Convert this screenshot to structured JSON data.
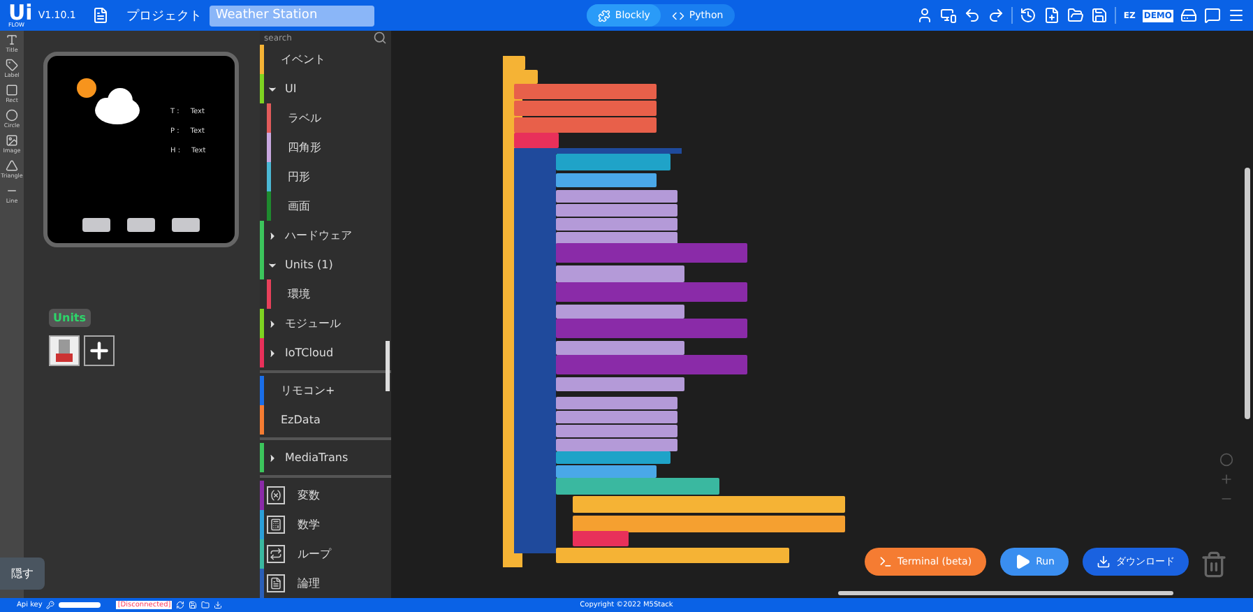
{
  "header": {
    "logo": "Ui",
    "logo_sub": "FLOW",
    "version": "V1.10.1",
    "project_label": "プロジェクト",
    "project_name": "Weather Station",
    "modes": [
      {
        "label": "Blockly",
        "selected": true
      },
      {
        "label": "Python",
        "selected": false
      }
    ],
    "toolbar": [
      {
        "kind": "user"
      },
      {
        "kind": "device"
      },
      {
        "kind": "undo"
      },
      {
        "kind": "redo"
      },
      {
        "kind": "sep"
      },
      {
        "kind": "history"
      },
      {
        "kind": "new"
      },
      {
        "kind": "open"
      },
      {
        "kind": "save"
      },
      {
        "kind": "sep"
      },
      {
        "kind": "ez",
        "label": "EZ"
      },
      {
        "kind": "demo",
        "label": "DEMO"
      },
      {
        "kind": "device2"
      },
      {
        "kind": "chat"
      },
      {
        "kind": "menu"
      }
    ]
  },
  "tools": [
    {
      "label": "Title",
      "kind": "title"
    },
    {
      "label": "Label",
      "kind": "label"
    },
    {
      "label": "Rect",
      "kind": "rect"
    },
    {
      "label": "Circle",
      "kind": "circle"
    },
    {
      "label": "Image",
      "kind": "image"
    },
    {
      "label": "Triangle",
      "kind": "triangle"
    },
    {
      "label": "Line",
      "kind": "line"
    }
  ],
  "screen": {
    "rows": [
      {
        "key": "T :",
        "value": "Text"
      },
      {
        "key": "P :",
        "value": "Text"
      },
      {
        "key": "H :",
        "value": "Text"
      }
    ]
  },
  "units": {
    "title": "Units"
  },
  "hide_button": "隠す",
  "search": {
    "placeholder": "search"
  },
  "categories": [
    {
      "label": "イベント",
      "color": "#f5b335",
      "kind": "plain"
    },
    {
      "label": "UI",
      "color": "#7ed321",
      "kind": "group",
      "expanded": true
    },
    {
      "label": "ラベル",
      "color": "#e25b5b",
      "kind": "sub"
    },
    {
      "label": "四角形",
      "color": "#c9a8e0",
      "kind": "sub"
    },
    {
      "label": "円形",
      "color": "#4bb8d4",
      "kind": "sub"
    },
    {
      "label": "画面",
      "color": "#1e8a2e",
      "kind": "sub"
    },
    {
      "label": "ハードウェア",
      "color": "#3cc45c",
      "kind": "group",
      "expanded": false
    },
    {
      "label": "Units (1)",
      "color": "#3cc45c",
      "kind": "group",
      "expanded": true
    },
    {
      "label": "環境",
      "color": "#e8405a",
      "kind": "sub"
    },
    {
      "label": "モジュール",
      "color": "#7ed321",
      "kind": "group",
      "expanded": false
    },
    {
      "label": "IoTCloud",
      "color": "#e8305a",
      "kind": "group",
      "expanded": false
    },
    {
      "kind": "sep"
    },
    {
      "label": "リモコン+",
      "color": "#1a6ee8",
      "kind": "plain"
    },
    {
      "label": "EzData",
      "color": "#f57c32",
      "kind": "plain"
    },
    {
      "kind": "sep"
    },
    {
      "label": "MediaTrans",
      "color": "#3cc45c",
      "kind": "group",
      "expanded": false
    },
    {
      "kind": "sep"
    },
    {
      "label": "変数",
      "color": "#8a2ba8",
      "kind": "icon"
    },
    {
      "label": "数学",
      "color": "#2b9fd8",
      "kind": "icon"
    },
    {
      "label": "ループ",
      "color": "#3ab8a0",
      "kind": "icon"
    },
    {
      "label": "論理",
      "color": "#2b5fb8",
      "kind": "icon"
    }
  ],
  "actions": [
    {
      "label": "Terminal (beta)",
      "kind": "terminal"
    },
    {
      "label": "Run",
      "kind": "run"
    },
    {
      "label": "ダウンロード",
      "kind": "download"
    }
  ],
  "status": {
    "api_key_label": "Api key",
    "connection": "[Disconnected]",
    "copyright": "Copyright ©2022 M5Stack"
  }
}
